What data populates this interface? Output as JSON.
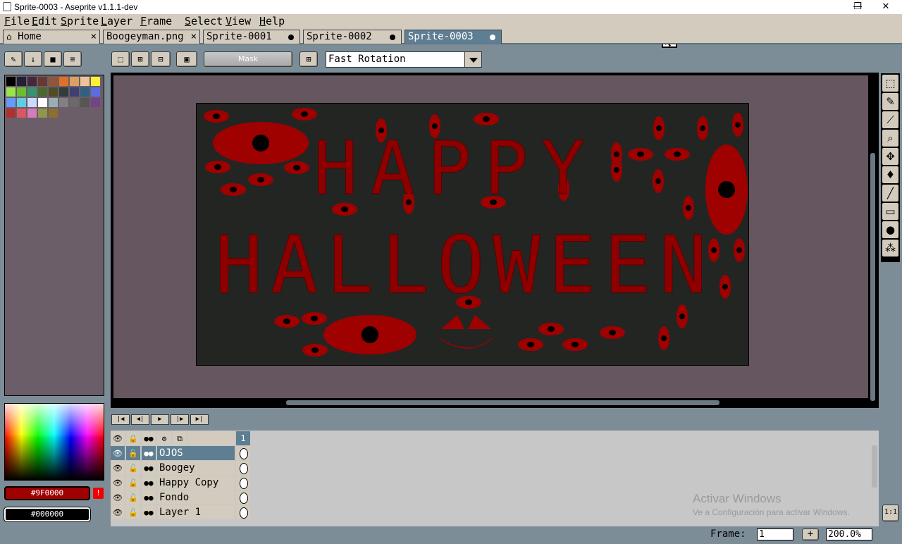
{
  "window": {
    "title": "Sprite-0003 - Aseprite v1.1.1-dev",
    "minimize": "—",
    "maximize": "❐",
    "close": "✕"
  },
  "menu": [
    "File",
    "Edit",
    "Sprite",
    "Layer",
    "Frame",
    "Select",
    "View",
    "Help"
  ],
  "tabs": [
    {
      "label": "Home",
      "state": "close"
    },
    {
      "label": "Boogeyman.png",
      "state": "close"
    },
    {
      "label": "Sprite-0001",
      "state": "modified"
    },
    {
      "label": "Sprite-0002",
      "state": "modified"
    },
    {
      "label": "Sprite-0003",
      "state": "modified",
      "active": true
    }
  ],
  "toolbar": {
    "mask_label": "Mask",
    "rotation_algorithm": "Fast Rotation"
  },
  "palette": {
    "colors": [
      "#000000",
      "#222034",
      "#45283c",
      "#663931",
      "#8f563b",
      "#df7126",
      "#d9a066",
      "#eec39a",
      "#fbf236",
      "#99e550",
      "#6abe30",
      "#37946e",
      "#4b692f",
      "#524b24",
      "#323c39",
      "#3f3f74",
      "#306082",
      "#5b6ee1",
      "#639bff",
      "#5fcde4",
      "#cbdbfc",
      "#ffffff",
      "#9badb7",
      "#847e87",
      "#696a6a",
      "#595652",
      "#76428a",
      "#ac3232",
      "#d95763",
      "#d77bba",
      "#8f974a",
      "#8a6f30"
    ]
  },
  "colors": {
    "foreground": "#9F0000",
    "background": "#000000",
    "accent": "#9f0000"
  },
  "canvas": {
    "line1": "HAPPY",
    "line2": "HALLOWEEN"
  },
  "layers": [
    {
      "name": "OJOS",
      "active": true
    },
    {
      "name": "Boogey"
    },
    {
      "name": "Happy Copy"
    },
    {
      "name": "Fondo"
    },
    {
      "name": "Layer 1"
    }
  ],
  "timeline": {
    "frame_header": "1"
  },
  "watermark": {
    "title": "Activar Windows",
    "subtitle": "Ve a Configuración para activar Windows."
  },
  "status": {
    "frame_label": "Frame:",
    "frame_value": "1",
    "add_frame": "+",
    "zoom": "200.0%"
  },
  "tools": [
    "marquee-icon",
    "pencil-icon",
    "eyedropper-icon",
    "zoom-icon",
    "move-icon",
    "fill-icon",
    "line-icon",
    "rectangle-icon",
    "blob-icon",
    "spray-icon"
  ]
}
